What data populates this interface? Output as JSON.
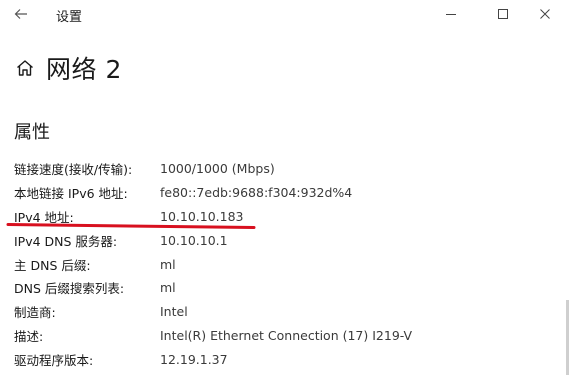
{
  "titlebar": {
    "title": "设置",
    "icons": {
      "back": "back-arrow-icon",
      "minimize": "minimize-icon",
      "maximize": "maximize-icon",
      "close": "close-icon"
    }
  },
  "page": {
    "title": "网络 2",
    "icon": "home-icon"
  },
  "section": {
    "title": "属性"
  },
  "properties": [
    {
      "label": "链接速度(接收/传输):",
      "value": "1000/1000 (Mbps)"
    },
    {
      "label": "本地链接 IPv6 地址:",
      "value": "fe80::7edb:9688:f304:932d%4"
    },
    {
      "label": "IPv4 地址:",
      "value": "10.10.10.183"
    },
    {
      "label": "IPv4 DNS 服务器:",
      "value": "10.10.10.1"
    },
    {
      "label": "主 DNS 后缀:",
      "value": "ml"
    },
    {
      "label": "DNS 后缀搜索列表:",
      "value": "ml"
    },
    {
      "label": "制造商:",
      "value": "Intel"
    },
    {
      "label": "描述:",
      "value": "Intel(R) Ethernet Connection (17) I219-V"
    },
    {
      "label": "驱动程序版本:",
      "value": "12.19.1.37"
    }
  ],
  "colors": {
    "annotation": "#d8101f",
    "background": "#ffffff",
    "text": "#1a1a1a"
  }
}
